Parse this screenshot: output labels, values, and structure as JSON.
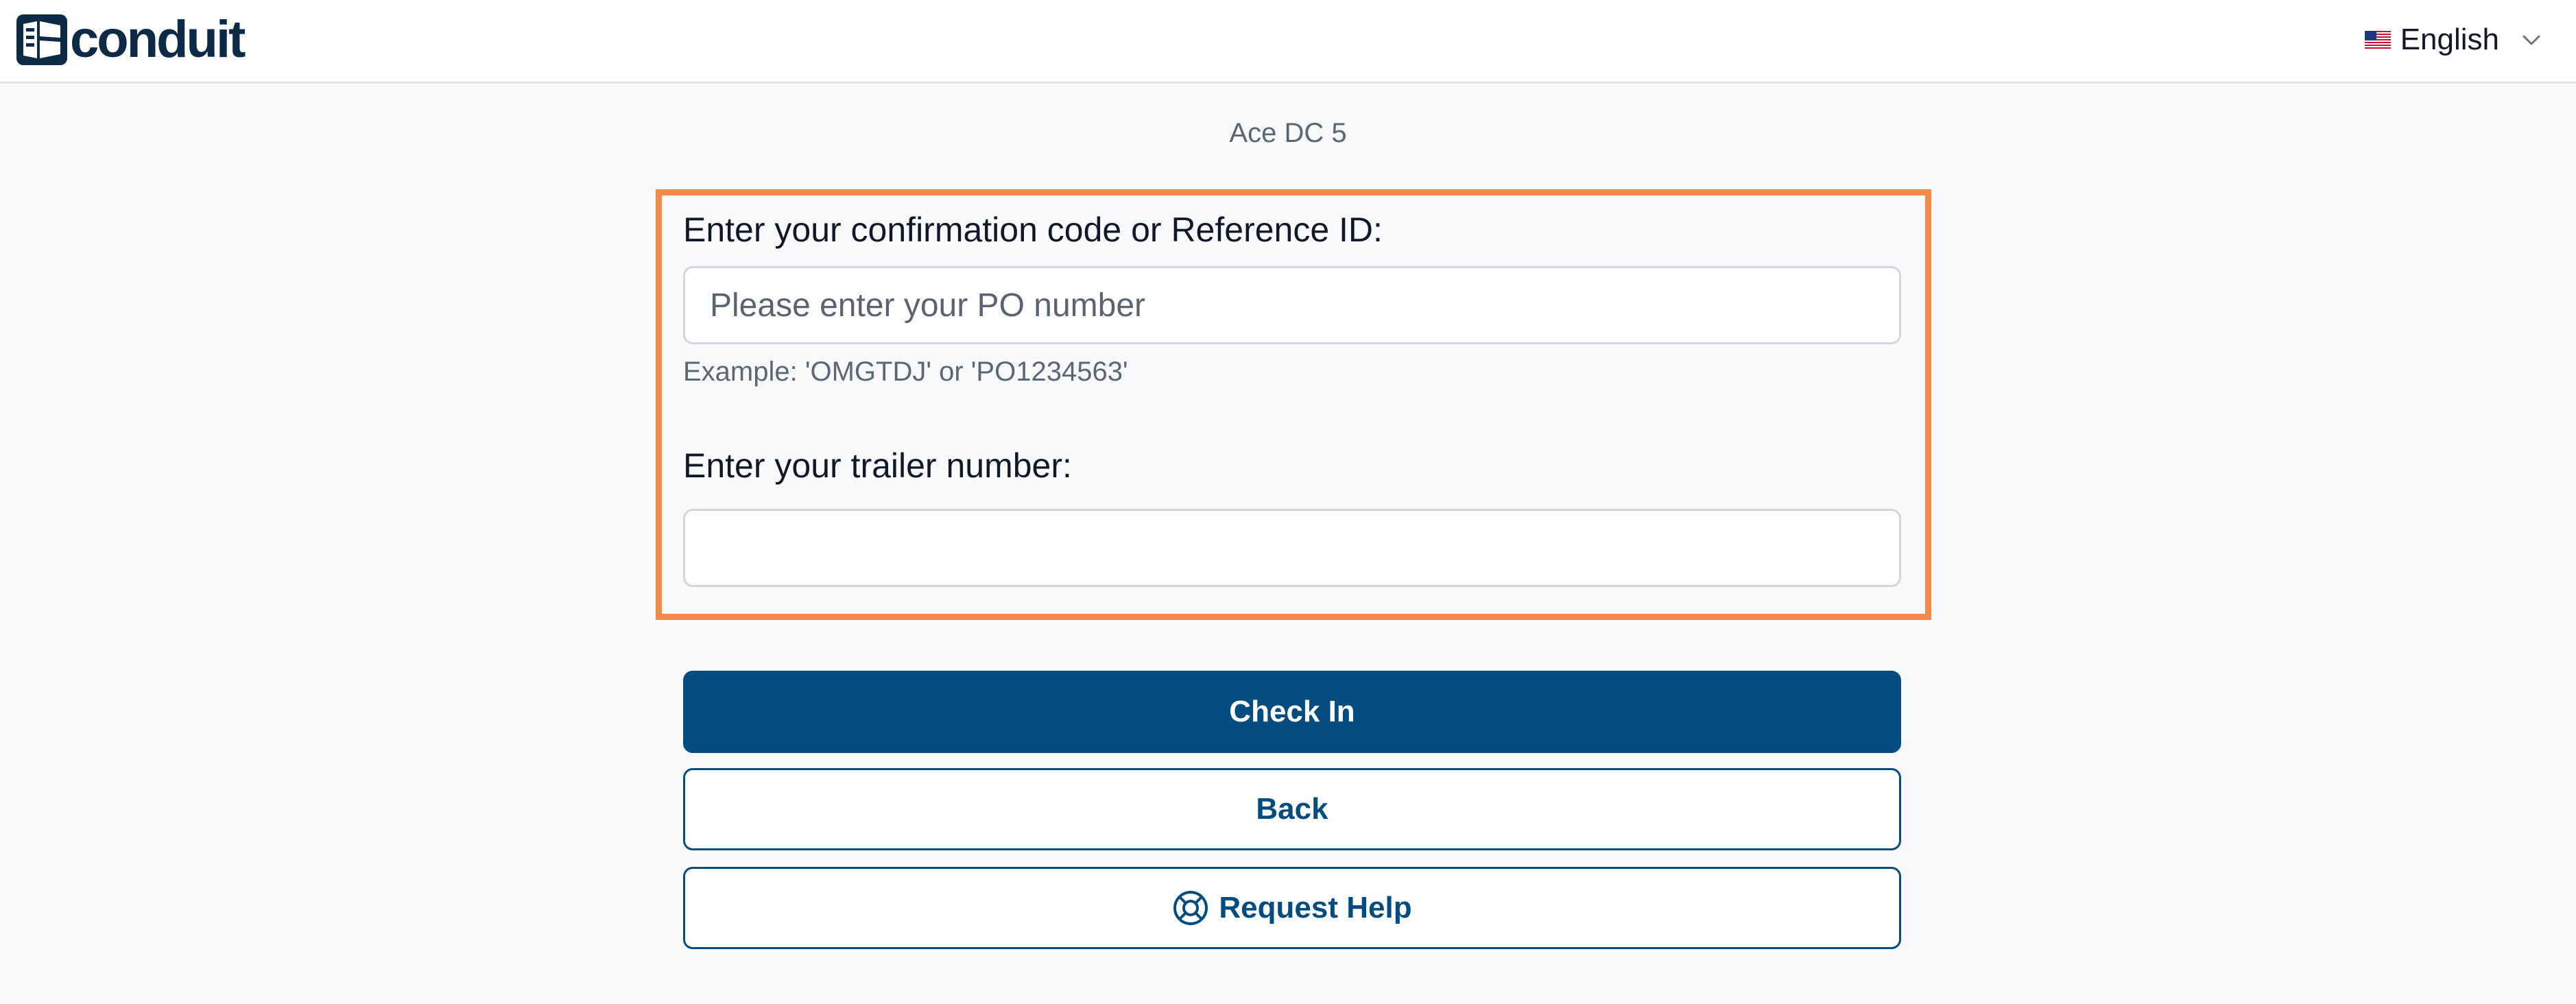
{
  "header": {
    "logo_text": "conduit",
    "language": "English"
  },
  "site": {
    "name": "Ace DC 5"
  },
  "form": {
    "confirmation_label": "Enter your confirmation code or Reference ID:",
    "confirmation_placeholder": "Please enter your PO number",
    "confirmation_value": "",
    "confirmation_hint": "Example: 'OMGTDJ' or 'PO1234563'",
    "trailer_label": "Enter your trailer number:",
    "trailer_value": "",
    "highlight_color": "#f48a48"
  },
  "actions": {
    "check_in": "Check In",
    "back": "Back",
    "request_help": "Request Help"
  },
  "colors": {
    "primary": "#034c80",
    "brand": "#0d2a47"
  },
  "icons": {
    "logo": "conduit-logo-icon",
    "flag": "us-flag-icon",
    "dropdown": "chevron-down-icon",
    "help": "lifebuoy-icon"
  }
}
